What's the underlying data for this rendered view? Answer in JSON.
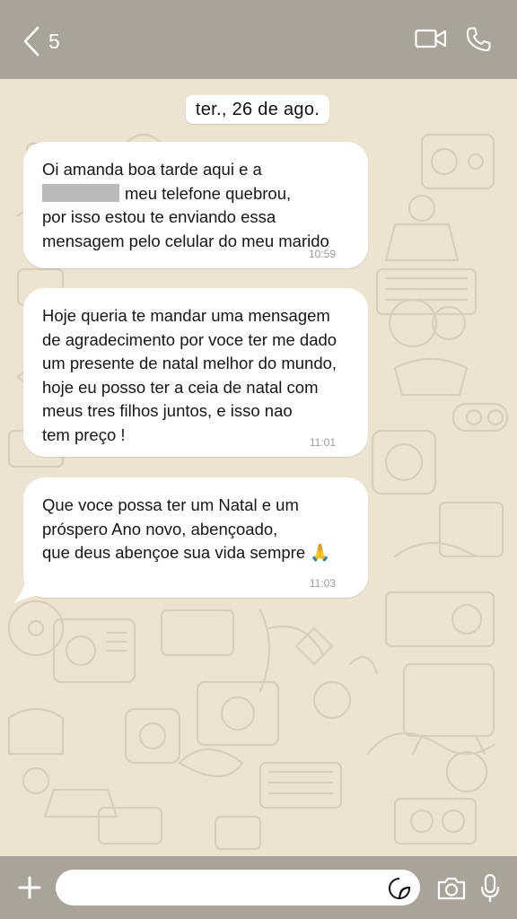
{
  "header": {
    "unread_count": "5",
    "icons": [
      "back-chevron-icon",
      "video-call-icon",
      "phone-call-icon"
    ]
  },
  "chat": {
    "date_label": "ter., 26 de ago.",
    "messages": [
      {
        "lines_before_redaction": [],
        "redacted_line_suffix": "meu telefone quebrou,",
        "line1": "Oi amanda boa tarde aqui e a",
        "line3": "por isso estou te enviando essa",
        "line4": "mensagem pelo celular do meu marido",
        "time": "10:59"
      },
      {
        "lines": [
          "Hoje queria te mandar uma mensagem",
          "de agradecimento por voce ter me dado",
          "um presente de natal melhor do mundo,",
          "hoje eu posso ter a ceia de natal com",
          "meus tres filhos juntos, e isso nao",
          "tem preço !"
        ],
        "time": "11:01"
      },
      {
        "lines": [
          "Que voce possa ter um Natal e um",
          "próspero Ano novo, abençoado,",
          "que deus abençoe sua vida sempre 🙏"
        ],
        "time": "11:03"
      }
    ]
  },
  "composer": {
    "placeholder": "",
    "icons": [
      "plus-icon",
      "sticker-icon",
      "camera-icon",
      "microphone-icon"
    ]
  },
  "colors": {
    "bar": "#a9a39a",
    "background": "#ece3d1",
    "bubble": "#ffffff",
    "redaction": "#b9b9b9"
  }
}
